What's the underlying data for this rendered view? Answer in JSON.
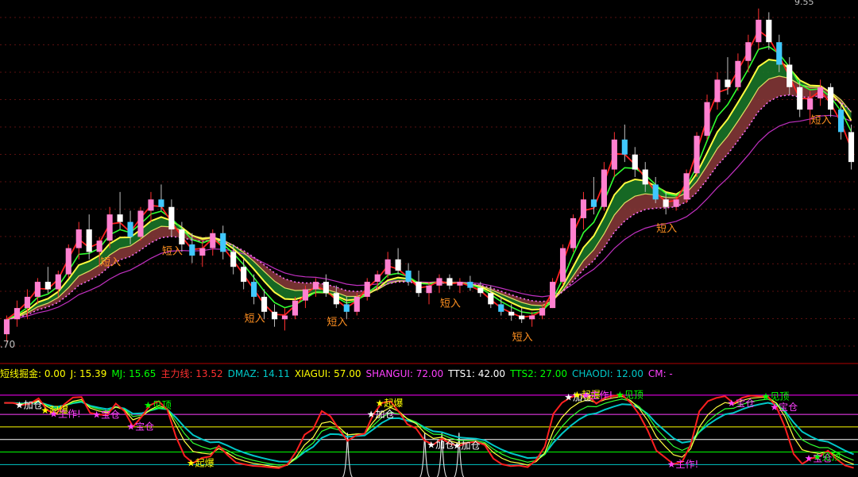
{
  "chart_data": {
    "type": "line",
    "price_panel": {
      "axis_left_label": ".70",
      "axis_top_right_label": "9.55",
      "signal_label": "短入",
      "candles": [
        [
          0,
          5.2,
          5.45,
          5.1,
          5.4
        ],
        [
          1,
          5.4,
          5.65,
          5.3,
          5.55
        ],
        [
          2,
          5.55,
          5.8,
          5.4,
          5.7
        ],
        [
          3,
          5.7,
          5.95,
          5.6,
          5.9
        ],
        [
          4,
          5.9,
          6.1,
          5.75,
          5.8
        ],
        [
          5,
          5.8,
          6.05,
          5.7,
          6.0
        ],
        [
          6,
          6.0,
          6.4,
          5.95,
          6.35
        ],
        [
          7,
          6.35,
          6.7,
          6.2,
          6.6
        ],
        [
          8,
          6.6,
          6.8,
          6.2,
          6.3
        ],
        [
          9,
          6.3,
          6.5,
          6.1,
          6.45
        ],
        [
          10,
          6.45,
          6.9,
          6.35,
          6.8
        ],
        [
          11,
          6.8,
          7.1,
          6.6,
          6.7
        ],
        [
          12,
          6.7,
          6.85,
          6.4,
          6.5
        ],
        [
          13,
          6.5,
          6.9,
          6.45,
          6.85
        ],
        [
          14,
          6.85,
          7.1,
          6.7,
          7.0
        ],
        [
          15,
          7.0,
          7.2,
          6.85,
          6.9
        ],
        [
          16,
          6.9,
          7.0,
          6.5,
          6.6
        ],
        [
          17,
          6.6,
          6.7,
          6.3,
          6.4
        ],
        [
          18,
          6.4,
          6.55,
          6.15,
          6.25
        ],
        [
          19,
          6.25,
          6.45,
          6.1,
          6.35
        ],
        [
          20,
          6.35,
          6.6,
          6.25,
          6.55
        ],
        [
          21,
          6.55,
          6.65,
          6.2,
          6.3
        ],
        [
          22,
          6.3,
          6.4,
          6.0,
          6.1
        ],
        [
          23,
          6.1,
          6.2,
          5.8,
          5.9
        ],
        [
          24,
          5.9,
          6.0,
          5.6,
          5.7
        ],
        [
          25,
          5.7,
          5.8,
          5.4,
          5.5
        ],
        [
          26,
          5.5,
          5.6,
          5.3,
          5.4
        ],
        [
          27,
          5.4,
          5.55,
          5.25,
          5.45
        ],
        [
          28,
          5.45,
          5.7,
          5.4,
          5.65
        ],
        [
          29,
          5.65,
          5.85,
          5.55,
          5.8
        ],
        [
          30,
          5.8,
          5.95,
          5.7,
          5.9
        ],
        [
          31,
          5.9,
          6.0,
          5.7,
          5.75
        ],
        [
          32,
          5.75,
          5.85,
          5.55,
          5.6
        ],
        [
          33,
          5.6,
          5.7,
          5.4,
          5.5
        ],
        [
          34,
          5.5,
          5.75,
          5.45,
          5.7
        ],
        [
          35,
          5.7,
          5.95,
          5.65,
          5.9
        ],
        [
          36,
          5.9,
          6.05,
          5.8,
          6.0
        ],
        [
          37,
          6.0,
          6.3,
          5.95,
          6.2
        ],
        [
          38,
          6.2,
          6.35,
          6.0,
          6.05
        ],
        [
          39,
          6.05,
          6.15,
          5.85,
          5.9
        ],
        [
          40,
          5.9,
          6.05,
          5.7,
          5.75
        ],
        [
          41,
          5.75,
          5.9,
          5.6,
          5.85
        ],
        [
          42,
          5.85,
          6.0,
          5.75,
          5.95
        ],
        [
          43,
          5.95,
          6.0,
          5.8,
          5.85
        ],
        [
          44,
          5.85,
          5.95,
          5.75,
          5.9
        ],
        [
          45,
          5.9,
          5.98,
          5.78,
          5.82
        ],
        [
          46,
          5.82,
          5.9,
          5.7,
          5.75
        ],
        [
          47,
          5.75,
          5.85,
          5.55,
          5.6
        ],
        [
          48,
          5.6,
          5.7,
          5.45,
          5.5
        ],
        [
          49,
          5.5,
          5.6,
          5.38,
          5.45
        ],
        [
          50,
          5.45,
          5.55,
          5.35,
          5.4
        ],
        [
          51,
          5.4,
          5.5,
          5.3,
          5.45
        ],
        [
          52,
          5.45,
          5.6,
          5.4,
          5.55
        ],
        [
          53,
          5.55,
          5.95,
          5.55,
          5.9
        ],
        [
          54,
          5.9,
          6.4,
          5.85,
          6.35
        ],
        [
          55,
          6.35,
          6.8,
          6.3,
          6.75
        ],
        [
          56,
          6.75,
          7.1,
          6.6,
          7.0
        ],
        [
          57,
          7.0,
          7.3,
          6.8,
          6.9
        ],
        [
          58,
          6.9,
          7.5,
          6.85,
          7.4
        ],
        [
          59,
          7.4,
          7.9,
          7.3,
          7.8
        ],
        [
          60,
          7.8,
          8.0,
          7.5,
          7.6
        ],
        [
          61,
          7.6,
          7.7,
          7.3,
          7.4
        ],
        [
          62,
          7.4,
          7.5,
          7.1,
          7.2
        ],
        [
          63,
          7.2,
          7.3,
          6.95,
          7.0
        ],
        [
          64,
          7.0,
          7.1,
          6.8,
          6.9
        ],
        [
          65,
          6.9,
          7.05,
          6.85,
          7.0
        ],
        [
          66,
          7.0,
          7.4,
          6.95,
          7.35
        ],
        [
          67,
          7.35,
          7.9,
          7.3,
          7.85
        ],
        [
          68,
          7.85,
          8.4,
          7.8,
          8.3
        ],
        [
          69,
          8.3,
          8.7,
          8.2,
          8.6
        ],
        [
          70,
          8.6,
          8.9,
          8.4,
          8.5
        ],
        [
          71,
          8.5,
          8.95,
          8.45,
          8.85
        ],
        [
          72,
          8.85,
          9.2,
          8.7,
          9.1
        ],
        [
          73,
          9.1,
          9.55,
          9.0,
          9.4
        ],
        [
          74,
          9.4,
          9.5,
          9.0,
          9.1
        ],
        [
          75,
          9.1,
          9.2,
          8.7,
          8.8
        ],
        [
          76,
          8.8,
          8.9,
          8.4,
          8.5
        ],
        [
          77,
          8.5,
          8.6,
          8.1,
          8.2
        ],
        [
          78,
          8.2,
          8.45,
          8.0,
          8.35
        ],
        [
          79,
          8.35,
          8.6,
          8.25,
          8.5
        ],
        [
          80,
          8.5,
          8.55,
          8.1,
          8.2
        ],
        [
          81,
          8.2,
          8.3,
          7.8,
          7.9
        ],
        [
          82,
          7.9,
          8.0,
          7.4,
          7.5
        ]
      ],
      "signals": [
        10,
        16,
        24,
        32,
        43,
        50,
        64,
        79
      ]
    },
    "indicator_panel": {
      "readouts": [
        {
          "key": "short_gold",
          "text": "短线掘金: 0.00",
          "color": "#ffff00"
        },
        {
          "key": "J",
          "text": "J: 15.39",
          "color": "#ffff00"
        },
        {
          "key": "MJ",
          "text": "MJ: 15.65",
          "color": "#00ff00"
        },
        {
          "key": "main",
          "text": "主力线: 13.52",
          "color": "#ff3030"
        },
        {
          "key": "DMAZ",
          "text": "DMAZ: 14.11",
          "color": "#00c8c8"
        },
        {
          "key": "XIAGUI",
          "text": "XIAGUI: 57.00",
          "color": "#ffff00"
        },
        {
          "key": "SHANGUI",
          "text": "SHANGUI: 72.00",
          "color": "#ff40ff"
        },
        {
          "key": "TTS1",
          "text": "TTS1: 42.00",
          "color": "#ffffff"
        },
        {
          "key": "TTS2",
          "text": "TTS2: 27.00",
          "color": "#00ff00"
        },
        {
          "key": "CHAODI",
          "text": "CHAODI: 12.00",
          "color": "#00c8c8"
        },
        {
          "key": "CM",
          "text": "CM: -",
          "color": "#ff40ff"
        }
      ],
      "hlines": [
        {
          "y": 95,
          "color": "#ff00ff"
        },
        {
          "y": 72,
          "color": "#ff40ff"
        },
        {
          "y": 57,
          "color": "#ffff00"
        },
        {
          "y": 42,
          "color": "#ffffff"
        },
        {
          "y": 27,
          "color": "#00ff00"
        },
        {
          "y": 12,
          "color": "#00c8c8"
        }
      ],
      "ylim": [
        0,
        110
      ],
      "markers": [
        {
          "i": 2,
          "text": "★加仓",
          "color": "#ffffff"
        },
        {
          "i": 5,
          "text": "★起爆",
          "color": "#ffff00"
        },
        {
          "i": 6,
          "text": "★主作!",
          "color": "#ff40ff"
        },
        {
          "i": 11,
          "text": "★宝仓",
          "color": "#ff40ff"
        },
        {
          "i": 15,
          "text": "★宝仓",
          "color": "#ff40ff"
        },
        {
          "i": 17,
          "text": "★见顶",
          "color": "#00ff00"
        },
        {
          "i": 22,
          "text": "★起爆",
          "color": "#ffff00"
        },
        {
          "i": 43,
          "text": "★加仓",
          "color": "#ffffff"
        },
        {
          "i": 44,
          "text": "★起爆",
          "color": "#ffff00"
        },
        {
          "i": 50,
          "text": "★加仓",
          "color": "#ffffff"
        },
        {
          "i": 53,
          "text": "★加仓",
          "color": "#ffffff"
        },
        {
          "i": 66,
          "text": "★加仓",
          "color": "#ffffff"
        },
        {
          "i": 67,
          "text": "★起爆",
          "color": "#ffff00"
        },
        {
          "i": 68,
          "text": "★主作!",
          "color": "#ff40ff"
        },
        {
          "i": 72,
          "text": "★见顶",
          "color": "#00ff00"
        },
        {
          "i": 78,
          "text": "★主作!",
          "color": "#ff40ff"
        },
        {
          "i": 85,
          "text": "★宝仓",
          "color": "#ff40ff"
        },
        {
          "i": 89,
          "text": "★见顶",
          "color": "#00ff00"
        },
        {
          "i": 90,
          "text": "★宝仓",
          "color": "#ff40ff"
        },
        {
          "i": 94,
          "text": "★宝仓",
          "color": "#ff40ff"
        },
        {
          "i": 95,
          "text": "★见顶",
          "color": "#00ff00"
        }
      ],
      "spikes": [
        40,
        49,
        51,
        53
      ]
    }
  }
}
